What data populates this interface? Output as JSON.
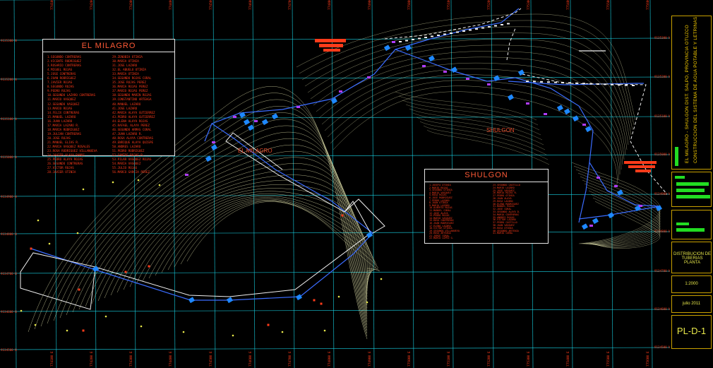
{
  "colors": {
    "background": "#000000",
    "grid": "#19d4e6",
    "contour": "#e8e8b0",
    "pipe": "#3a6cff",
    "house": "#1e88ff",
    "border": "#c8a000",
    "annotation": "#ff3b1a",
    "title_text": "#ffd400",
    "accent": "#22dd22"
  },
  "legend_milagro": {
    "title": "EL MILAGRO",
    "col1": [
      "1.SEGUNDO CONTRERAS",
      "2.VICENTE RODRIGUEZ",
      "3.ROSARIO CONTRERAS",
      "4.MIGUEL ROJAS",
      "5.JOSE CONTRERAS",
      "6.JUAN RODRIGUEZ",
      "7.JAVIER ROJAS",
      "8.SEGUNDO ROJAS",
      "9.PEDRO ROJAS",
      "10.SEGUNDO LAZARO CONTRERAS",
      "11.MARIO VASQUEZ",
      "12.SEGUNDO VASQUEZ",
      "13.MARIO ROJAS",
      "14.FELIX CONTRERAS",
      "15.MANUEL LAZARO",
      "16.JUAN LAZARO",
      "17.MARIA LAZARO R.",
      "18.MARIA RODRIGUEZ",
      "19.JULIAN CONTRERAS",
      "20.JOSE ROJAS",
      "21.MANUEL ELIAS R.",
      "22.MARIA VASQUEZ ROSALES",
      "23.ROSA RODRIGUEZ VILLANUEVA",
      "24.JAVIER ALAYA RAMOS",
      "25.PEDRO ALAYA ROJAS",
      "26.SEGUNDO CONTRERAS",
      "27.VICTOR ROJAS",
      "28.JAVIER OTINIA"
    ],
    "col2": [
      "29.ZENOBIA OTINIA",
      "30.MARIA OTINIA",
      "31.JOSE LAZARO",
      "32.EL ABUELO OTINIA",
      "33.MARIA OTINIA",
      "34.SEGUNDO ROJAS CORAL",
      "35.JOSE ROJAS PEREZ",
      "36.MARIA ROJAS PEREZ",
      "37.MARIO ROJAS PEREZ",
      "38.SEGUNDO MARIN ROJAS",
      "39.CONSTANTINO ARTEAGA",
      "40.MANUEL LAZARO",
      "41.JOSE LAZARO",
      "42.MARIA ALAYA GUTIERREZ",
      "43.PEDRO ALAYA GUTIERREZ",
      "44.ELENA ALAYA ROJAS",
      "45.RAFAEL ALAYA PEREZ",
      "46.SEGUNDO ARMAS CORAL",
      "47.JUAN LAZARO R.",
      "48.ROSA ALAYA CONTRERAS",
      "49.ENRIQUE ALAYA QUISPE",
      "50.ANDRES LAZARO",
      "51.PEDRO RODRIGUEZ",
      "52.SANTOS ROJAS R.",
      "53.PILAR VASQUEZ ROJAS",
      "54.MARIA VASQUEZ",
      "55.JULIO ROJAS",
      "56.MARCO GARCIA PEREZ"
    ]
  },
  "legend_shulgon": {
    "title": "SHULGON",
    "col1": [
      "1.JOSEFA OTINIA",
      "2.MARIO ROJAS",
      "3.SEGUNDO OTINIA",
      "4.MARIA VASQUEZ",
      "5.ROSA ROJAS",
      "6.JOSE RODRIGUEZ",
      "7.PEDRO LAZARO",
      "8.JUAN OTINIA",
      "9.MARIA LAZARO",
      "10.ALBERTO ROJAS",
      "11.MANUEL CORAL",
      "12.JOSE ALAYA",
      "13.PEDRO ROJAS",
      "14.MARIO VASQUEZ",
      "15.ROSA CONTRERAS",
      "16.JUAN RODRIGUEZ",
      "17.ELENA LAZARO",
      "18.VICTOR OTINIA",
      "19.SEGUNDO VILLANUEVA",
      "20.ROSA ARTEAGA",
      "21.JORGE CORAL",
      "22.MARCO LOPEZ G."
    ],
    "col2": [
      "23.SEGUNDO CASTILLO",
      "24.MARIO LAZARO",
      "25.JOSE VASQUEZ",
      "26.MARIA ROJAS R.",
      "27.PEDRO OTINIA",
      "28.JUAN ALAYA",
      "29.ROSA LAZARO",
      "30.ELENA RODRIGUEZ",
      "31.MANUEL ROJAS",
      "32.JOSE CORAL",
      "33.SEGUNDO ALAYA D.",
      "34.MARIA CONTRERAS",
      "35.ANDRES ROJAS",
      "36.VICTOR LAZARO",
      "37.PEDRO CASTILLO",
      "38.JUAN VASQUEZ",
      "39.ROSA OTINIA",
      "40.SEGUNDO ARTEAGA",
      "41.MARIO CORAL"
    ]
  },
  "map_labels": {
    "el_milagro": "EL MILAGRO",
    "shulgon": "SHULGON"
  },
  "title_block": {
    "project_line1": "CONSTRUCCION DEL SISTEMA DE AGUA POTABLE Y LETRINAS",
    "project_line2": "EL MILAGRO - SHULGON DIST. SALPO, PROVINCIA OTUZCO",
    "drawing_title": "DISTRIBUCION DE TUBERIAS PLANTA",
    "scale": "1:2000",
    "date": "julio 2011",
    "sheet": "PL-D-1"
  },
  "coordinates": {
    "eastings": [
      "774100 E",
      "774200 E",
      "774300 E",
      "774400 E",
      "774500 E",
      "774600 E",
      "774700 E",
      "774800 E",
      "774900 E",
      "775000 E",
      "775100 E",
      "775200 E",
      "775300 E",
      "775400 E",
      "775500 E",
      "775600 E"
    ],
    "northings": [
      "9135300 N",
      "9135200 N",
      "9135100 N",
      "9135000 N",
      "9134900 N",
      "9134800 N",
      "9134700 N",
      "9134600 N",
      "9134500 N"
    ]
  }
}
